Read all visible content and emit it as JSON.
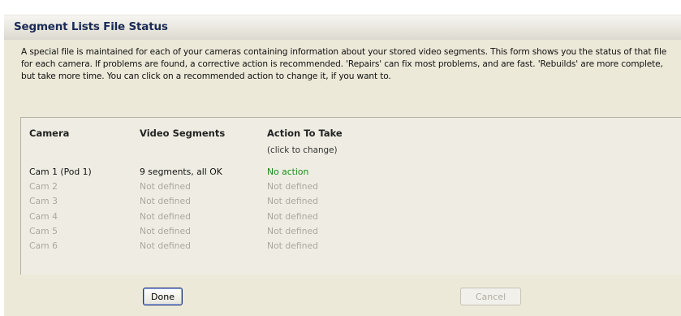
{
  "window": {
    "title": "Segment Lists File Status"
  },
  "description": "A special file is maintained for each of your cameras containing information about your stored video segments.  This form shows you the status of that file for each camera.  If problems are found, a corrective action is recommended.  'Repairs' can fix most problems, and are fast.  'Rebuilds' are more complete, but take more time.  You can click on a recommended action to change it, if you want to.",
  "table": {
    "headers": {
      "camera": "Camera",
      "segments": "Video Segments",
      "action": "Action To Take",
      "action_hint": "(click to change)"
    },
    "rows": [
      {
        "camera": "Cam 1  (Pod 1)",
        "segments": "9 segments, all OK",
        "action": "No action"
      },
      {
        "camera": "Cam 2",
        "segments": "Not defined",
        "action": "Not defined"
      },
      {
        "camera": "Cam 3",
        "segments": "Not defined",
        "action": "Not defined"
      },
      {
        "camera": "Cam 4",
        "segments": "Not defined",
        "action": "Not defined"
      },
      {
        "camera": "Cam 5",
        "segments": "Not defined",
        "action": "Not defined"
      },
      {
        "camera": "Cam 6",
        "segments": "Not defined",
        "action": "Not defined"
      }
    ]
  },
  "buttons": {
    "done": "Done",
    "cancel": "Cancel"
  },
  "colors": {
    "ok_text": "#1c8a1c",
    "disabled_text": "#a9a7a0",
    "title_text": "#1a2a55"
  }
}
